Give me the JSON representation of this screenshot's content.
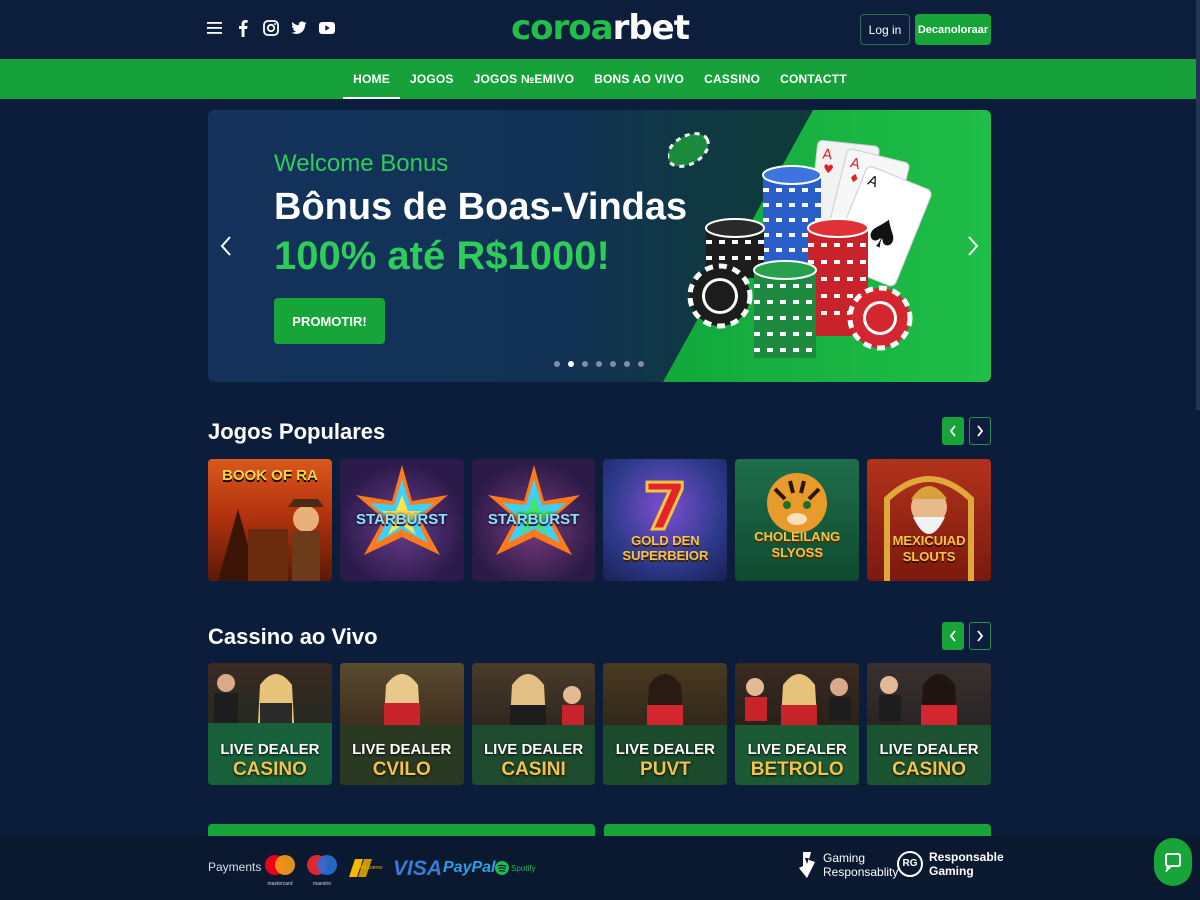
{
  "header": {
    "logo_main": "coroa",
    "logo_tail": "rbet",
    "login_label": "Log in",
    "signup_label": "Decanoloraar",
    "social_icons": [
      "menu-icon",
      "facebook-icon",
      "instagram-icon",
      "twitter-icon",
      "youtube-icon"
    ]
  },
  "nav": {
    "items": [
      {
        "label": "HOME",
        "active": true
      },
      {
        "label": "JOGOS"
      },
      {
        "label": "JOGOS №EMIVO"
      },
      {
        "label": "BONS AO VIVO"
      },
      {
        "label": "CASSINO"
      },
      {
        "label": "CONTACTT"
      }
    ]
  },
  "hero": {
    "eyebrow": "Welcome Bonus",
    "headline": "Bônus de Boas-Vindas",
    "amount": "100% até R$1000!",
    "cta_label": "PROMOTIR!",
    "slide_count": 7,
    "active_slide": 2
  },
  "popular": {
    "title": "Jogos Populares",
    "games": [
      {
        "name": "BOOK OF RA"
      },
      {
        "name": "STARBURST"
      },
      {
        "name": "STARBURST"
      },
      {
        "name": "GOLD DEN SUPERBEIOR"
      },
      {
        "name": "CHOLEILANG SLYOSS"
      },
      {
        "name": "MEXICUIAD SLOUTS"
      }
    ]
  },
  "live": {
    "title": "Cassino ao Vivo",
    "tables": [
      {
        "line1": "LIVE DEALER",
        "line2": "CASINO"
      },
      {
        "line1": "LIVE DEALER",
        "line2": "CVILO"
      },
      {
        "line1": "LIVE DEALER",
        "line2": "CASINI"
      },
      {
        "line1": "LIVE DEALER",
        "line2": "PUVT"
      },
      {
        "line1": "LIVE DEALER",
        "line2": "BETROLO"
      },
      {
        "line1": "LIVE DEALER",
        "line2": "CASINO"
      }
    ]
  },
  "footer": {
    "payments_label": "Payments",
    "payment_methods": [
      "mastercard",
      "maestro",
      "Rs coeres",
      "VISA",
      "PayPal",
      "Spotify"
    ],
    "mastercard_caption": "mastercard",
    "maestro_caption": "maestro",
    "coeres_caption": "Rs coeres",
    "visa_label": "VISA",
    "paypal_label": "PayPal",
    "spotify_label": "Spotify",
    "gaming_resp_line1": "Gaming",
    "gaming_resp_line2": "Responsablity",
    "rg_badge": "RG",
    "resp_gaming_line1": "Responsable",
    "resp_gaming_line2": "Gaming"
  },
  "colors": {
    "background": "#0c1d3b",
    "accent_green": "#17a53a",
    "bright_green": "#2ecc5a",
    "gold": "#f3c24c"
  }
}
